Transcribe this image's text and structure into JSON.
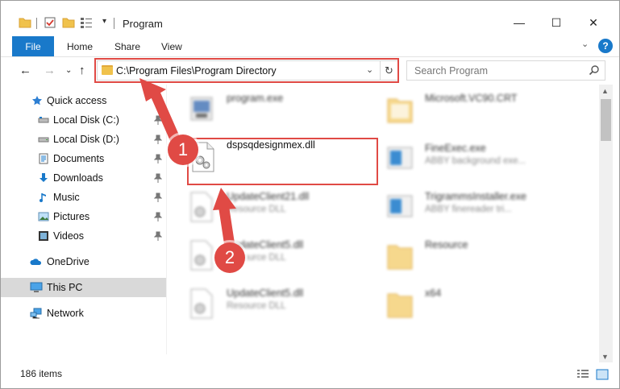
{
  "window": {
    "title": "Program",
    "controls": {
      "minimize": "—",
      "maximize": "☐",
      "close": "✕"
    }
  },
  "ribbon": {
    "tabs": [
      "File",
      "Home",
      "Share",
      "View"
    ],
    "help": "?"
  },
  "nav": {
    "address": "C:\\Program Files\\Program Directory",
    "search_placeholder": "Search Program"
  },
  "sidebar": {
    "items": [
      {
        "label": "Quick access",
        "icon": "star-icon"
      },
      {
        "label": "Local Disk (C:)",
        "icon": "drive-icon",
        "pinned": true
      },
      {
        "label": "Local Disk (D:)",
        "icon": "drive-icon",
        "pinned": true
      },
      {
        "label": "Documents",
        "icon": "documents-icon",
        "pinned": true
      },
      {
        "label": "Downloads",
        "icon": "downloads-icon",
        "pinned": true
      },
      {
        "label": "Music",
        "icon": "music-icon",
        "pinned": true
      },
      {
        "label": "Pictures",
        "icon": "pictures-icon",
        "pinned": true
      },
      {
        "label": "Videos",
        "icon": "videos-icon",
        "pinned": true
      },
      {
        "label": "OneDrive",
        "icon": "onedrive-icon"
      },
      {
        "label": "This PC",
        "icon": "this-pc-icon",
        "selected": true
      },
      {
        "label": "Network",
        "icon": "network-icon"
      }
    ]
  },
  "files": {
    "col1": [
      {
        "name": "program.exe",
        "sub": ""
      },
      {
        "name": "dspsqdesignmex.dll",
        "sub": ""
      },
      {
        "name": "UpdateClient21.dll",
        "sub": "Resource DLL"
      },
      {
        "name": "UpdateClient5.dll",
        "sub": "Resource DLL"
      },
      {
        "name": "UpdateClient5.dll",
        "sub": "Resource DLL"
      }
    ],
    "col2": [
      {
        "name": "Microsoft.VC90.CRT",
        "sub": ""
      },
      {
        "name": "FineExec.exe",
        "sub": "ABBY background exe..."
      },
      {
        "name": "TrigrammsInstaller.exe",
        "sub": "ABBY finereader tri..."
      },
      {
        "name": "Resource",
        "sub": ""
      },
      {
        "name": "x64",
        "sub": ""
      }
    ]
  },
  "status": {
    "items": "186 items"
  },
  "annotations": {
    "step1": "1",
    "step2": "2"
  },
  "colors": {
    "accent": "#1979ca",
    "highlight": "#e04a45",
    "selected": "#d9d9d9"
  }
}
